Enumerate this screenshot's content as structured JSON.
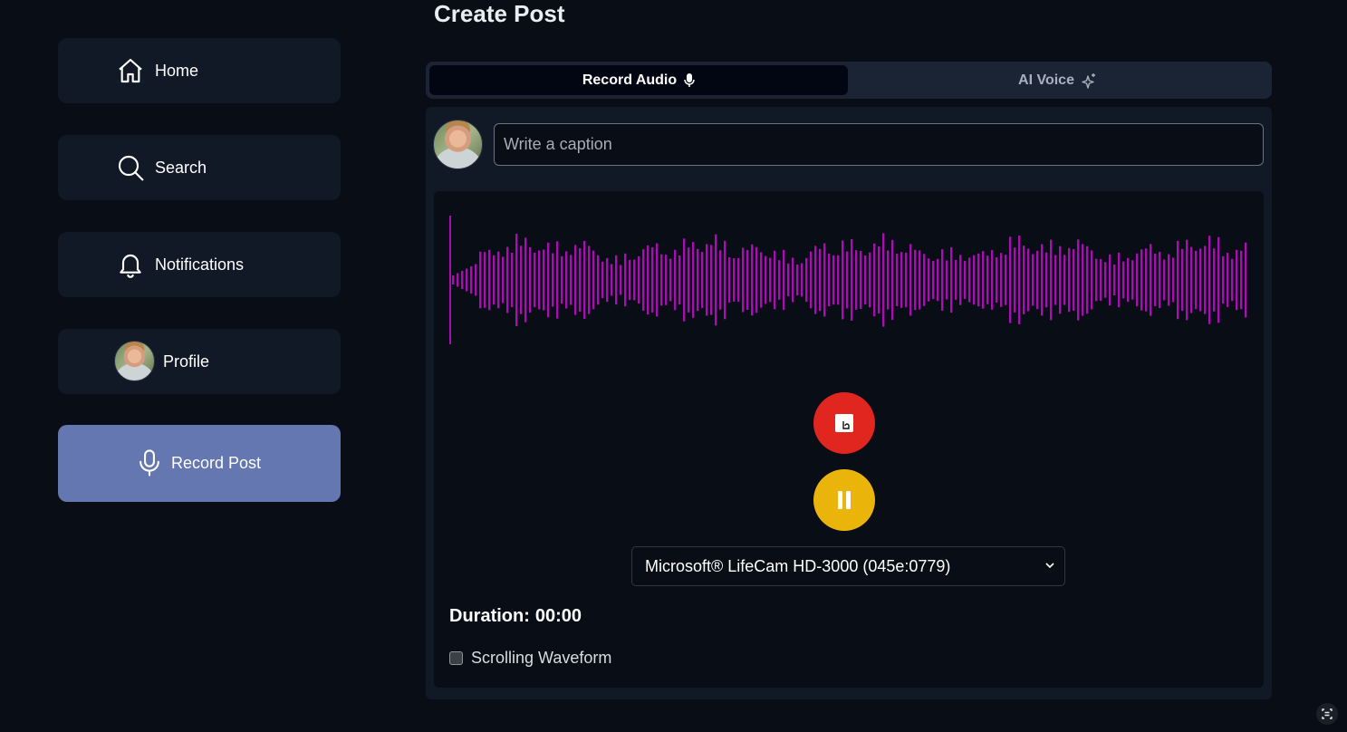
{
  "sidebar": {
    "items": [
      {
        "label": "Home",
        "icon": "home-icon"
      },
      {
        "label": "Search",
        "icon": "search-icon"
      },
      {
        "label": "Notifications",
        "icon": "bell-icon"
      },
      {
        "label": "Profile",
        "icon": "avatar"
      },
      {
        "label": "Record Post",
        "icon": "microphone-icon",
        "active": true
      }
    ]
  },
  "main": {
    "title": "Create Post",
    "tabs": [
      {
        "label": "Record Audio",
        "icon": "microphone-icon",
        "selected": true
      },
      {
        "label": "AI Voice",
        "icon": "sparkle-icon",
        "selected": false
      }
    ],
    "caption": {
      "placeholder": "Write a caption",
      "value": ""
    },
    "device_select": {
      "selected": "Microsoft® LifeCam HD-3000 (045e:0779)"
    },
    "duration": {
      "label": "Duration:",
      "value": "00:00"
    },
    "scrolling_waveform": {
      "label": "Scrolling Waveform",
      "checked": false
    }
  },
  "colors": {
    "background": "#090d16",
    "card": "#111826",
    "active_nav": "#6577b0",
    "waveform": "#a80fb0",
    "stop_button": "#e1251f",
    "pause_button": "#eab40b"
  }
}
